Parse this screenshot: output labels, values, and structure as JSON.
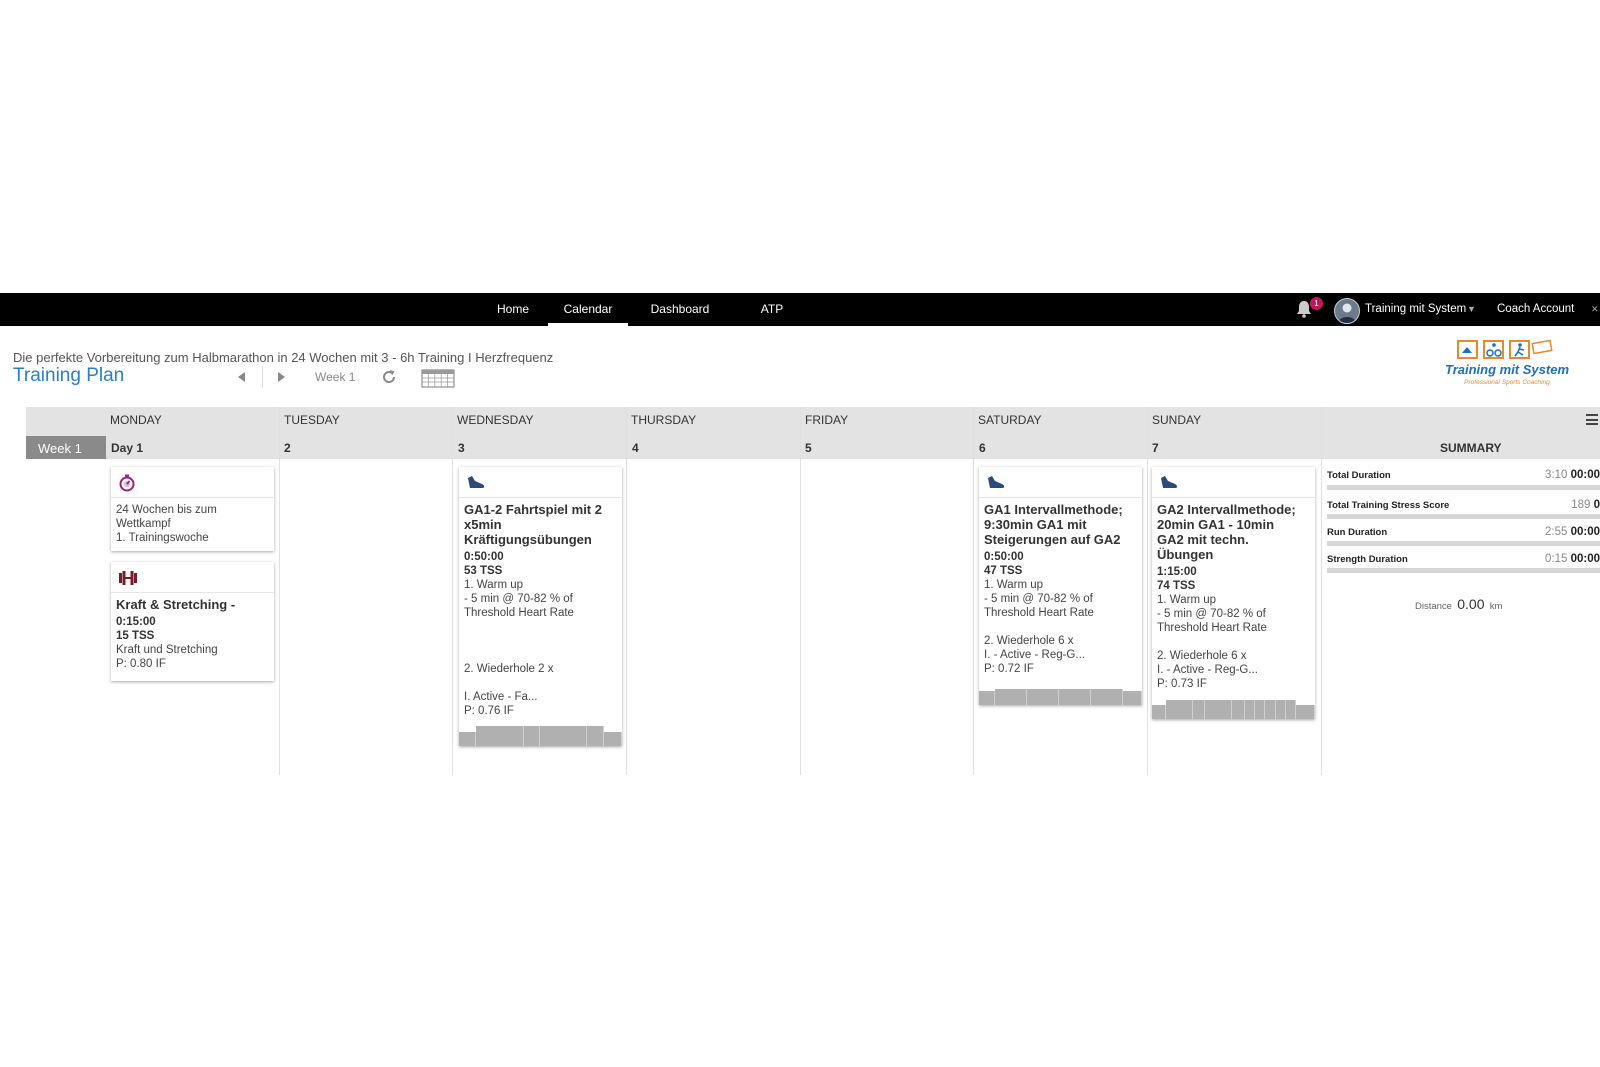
{
  "nav": {
    "items": [
      "Home",
      "Calendar",
      "Dashboard",
      "ATP"
    ],
    "active": "Calendar",
    "notification_count": "1",
    "user_name": "Training mit System",
    "coach_account": "Coach Account"
  },
  "plan": {
    "description": "Die perfekte Vorbereitung zum Halbmarathon in 24 Wochen mit 3 - 6h Training I Herzfrequenz",
    "title": "Training Plan",
    "week_label": "Week 1"
  },
  "logo": {
    "text": "Training mit System",
    "tagline": "Professional Sports Coaching"
  },
  "calendar": {
    "week_badge": "Week 1",
    "days": [
      {
        "name": "MONDAY",
        "num": "Day 1"
      },
      {
        "name": "TUESDAY",
        "num": "2"
      },
      {
        "name": "WEDNESDAY",
        "num": "3"
      },
      {
        "name": "THURSDAY",
        "num": "4"
      },
      {
        "name": "FRIDAY",
        "num": "5"
      },
      {
        "name": "SATURDAY",
        "num": "6"
      },
      {
        "name": "SUNDAY",
        "num": "7"
      }
    ],
    "summary_title": "SUMMARY"
  },
  "cards": {
    "note": {
      "icon": "stopwatch-icon",
      "lines": [
        "24 Wochen bis zum",
        "Wettkampf",
        "1. Trainingswoche"
      ]
    },
    "strength": {
      "icon": "dumbbell-icon",
      "title": "Kraft & Stretching -",
      "duration": "0:15:00",
      "tss": "15 TSS",
      "desc": "Kraft und Stretching",
      "intensity": "P: 0.80 IF"
    },
    "wed": {
      "icon": "running-shoe-icon",
      "title": [
        "GA1-2 Fahrtspiel  mit 2",
        "x5min",
        "Kräftigungsübungen"
      ],
      "duration": "0:50:00",
      "tss": "53 TSS",
      "desc": [
        "1. Warm up",
        "- 5 min @ 70-82 % of",
        "Threshold Heart Rate"
      ],
      "desc2": [
        "2. Wiederhole 2 x",
        "I. Active - Fa..."
      ],
      "intensity": "P: 0.76 IF"
    },
    "sat": {
      "icon": "running-shoe-icon",
      "title": [
        "GA1 Intervallmethode;",
        "9:30min GA1 mit",
        "Steigerungen auf GA2"
      ],
      "duration": "0:50:00",
      "tss": "47 TSS",
      "desc": [
        "1. Warm up",
        "- 5 min @ 70-82 % of",
        "Threshold Heart Rate"
      ],
      "desc2": [
        "2. Wiederhole  6 x",
        "I. - Active - Reg-G..."
      ],
      "intensity": "P: 0.72 IF"
    },
    "sun": {
      "icon": "running-shoe-icon",
      "title": [
        "GA2 Intervallmethode;",
        "20min GA1 - 10min",
        "GA2 mit techn.",
        "Übungen"
      ],
      "duration": "1:15:00",
      "tss": "74 TSS",
      "desc": [
        "1. Warm up",
        "- 5 min @ 70-82 % of",
        "Threshold Heart Rate"
      ],
      "desc2": [
        "2. Wiederhole  6 x",
        "I. - Active - Reg-G..."
      ],
      "intensity": "P: 0.73 IF"
    }
  },
  "summary": {
    "rows": [
      {
        "label": "Total Duration",
        "planned": "3:10",
        "actual": "00:00"
      },
      {
        "label": "Total Training Stress Score",
        "planned": "189",
        "actual": "0"
      },
      {
        "label": "Run Duration",
        "planned": "2:55",
        "actual": "00:00"
      },
      {
        "label": "Strength Duration",
        "planned": "0:15",
        "actual": "00:00"
      }
    ],
    "distance_label": "Distance",
    "distance_value": "0.00",
    "distance_unit": "km"
  },
  "colors": {
    "title_blue": "#2b7fc1",
    "badge": "#c2185b",
    "shoe": "#2a4a7a",
    "stopwatch": "#9c1d8a",
    "dumbbell": "#7a1b2a"
  }
}
